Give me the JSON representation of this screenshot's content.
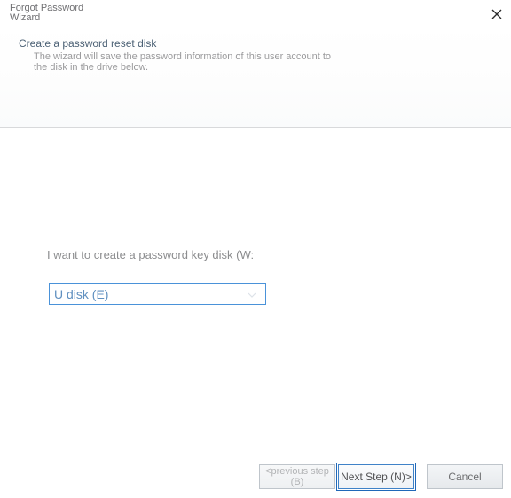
{
  "window": {
    "title": "Forgot Password\nWizard"
  },
  "header": {
    "heading": "Create a password reset disk",
    "subtext": "The wizard will save the password information of this user account to the disk in the drive below."
  },
  "body": {
    "prompt_label": "I want to create a password key disk (W:",
    "drive_select_value": "U disk (E)"
  },
  "footer": {
    "prev_line1": "<previous step",
    "prev_line2": "(B)",
    "next_label": "Next Step (N)>",
    "cancel_label": "Cancel"
  }
}
